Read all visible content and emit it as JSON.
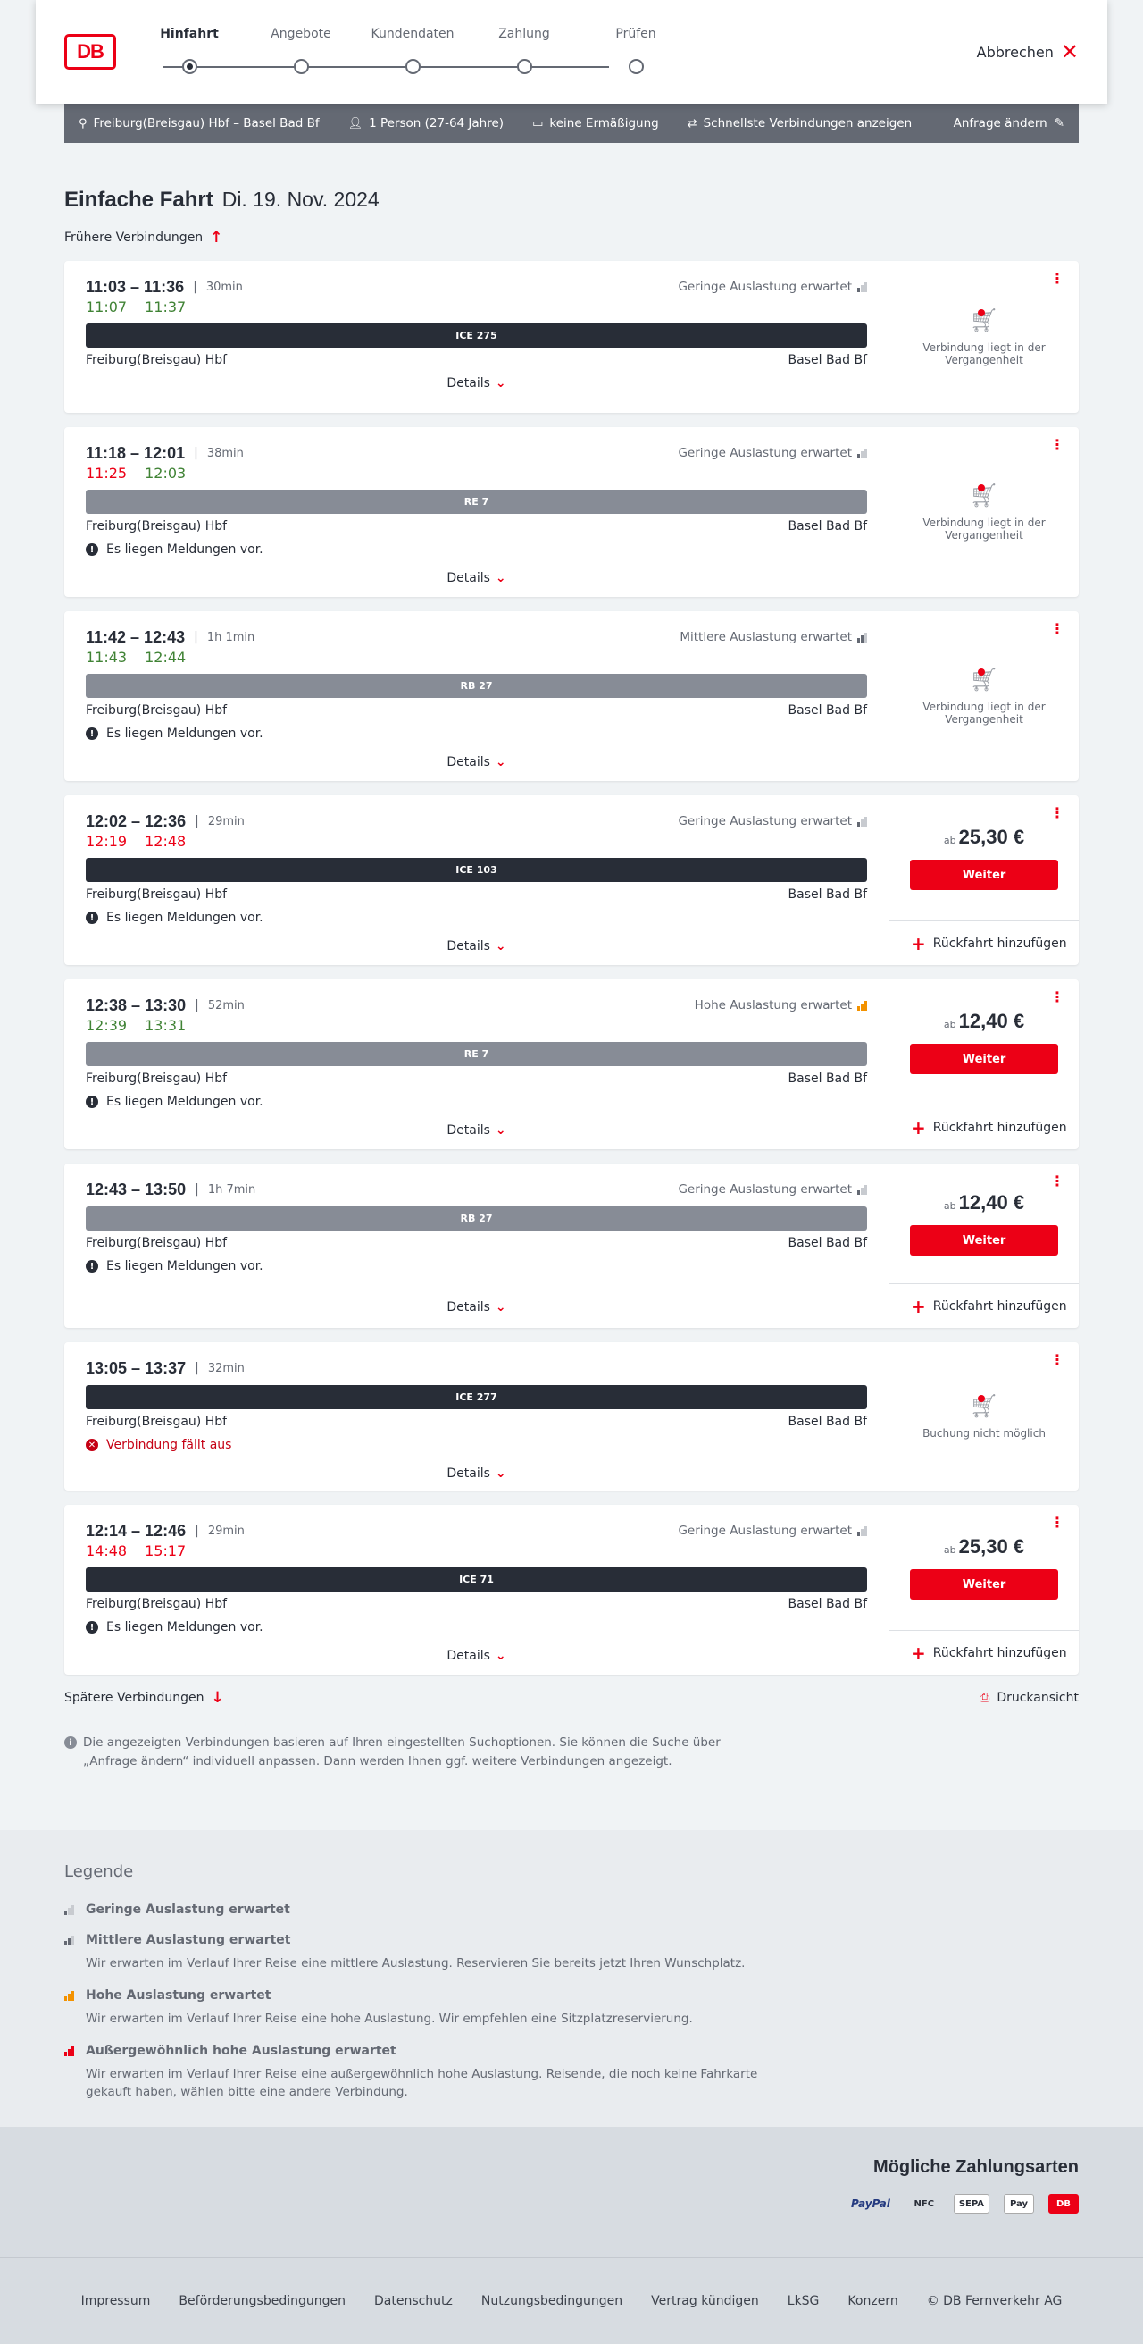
{
  "logo": "DB",
  "steps": [
    "Hinfahrt",
    "Angebote",
    "Kundendaten",
    "Zahlung",
    "Prüfen"
  ],
  "cancel": "Abbrechen",
  "summary": {
    "route": "Freiburg(Breisgau) Hbf – Basel Bad Bf",
    "persons": "1 Person (27-64 Jahre)",
    "discount": "keine Ermäßigung",
    "fastest": "Schnellste Verbindungen anzeigen",
    "edit": "Anfrage ändern"
  },
  "title": {
    "main": "Einfache Fahrt",
    "date": "Di. 19. Nov. 2024"
  },
  "earlier": "Frühere Verbindungen",
  "later": "Spätere Verbindungen",
  "print": "Druckansicht",
  "labels": {
    "details": "Details",
    "weiter": "Weiter",
    "return": "Rückfahrt hinzufügen",
    "ab": "ab",
    "past": "Verbindung liegt in der Vergangenheit",
    "notPossible": "Buchung nicht möglich",
    "notice": "Es liegen Meldungen vor.",
    "cancelled": "Verbindung fällt aus"
  },
  "connections": [
    {
      "times": "11:03 – 11:36",
      "duration": "30min",
      "load": "Geringe Auslastung erwartet",
      "loadLevel": 1,
      "rt": [
        {
          "t": "11:07",
          "c": "green"
        },
        {
          "t": "11:37",
          "c": "green"
        }
      ],
      "train": "ICE 275",
      "trainType": "ice",
      "from": "Freiburg(Breisgau) Hbf",
      "to": "Basel Bad Bf",
      "notice": "",
      "side": "past",
      "height": 170
    },
    {
      "times": "11:18 – 12:01",
      "duration": "38min",
      "load": "Geringe Auslastung erwartet",
      "loadLevel": 1,
      "rt": [
        {
          "t": "11:25",
          "c": "red"
        },
        {
          "t": "12:03",
          "c": "green"
        }
      ],
      "train": "RE 7",
      "trainType": "reg",
      "from": "Freiburg(Breisgau) Hbf",
      "to": "Basel Bad Bf",
      "notice": "notice",
      "side": "past",
      "height": 190
    },
    {
      "times": "11:42 – 12:43",
      "duration": "1h 1min",
      "load": "Mittlere Auslastung erwartet",
      "loadLevel": 2,
      "rt": [
        {
          "t": "11:43",
          "c": "green"
        },
        {
          "t": "12:44",
          "c": "green"
        }
      ],
      "train": "RB 27",
      "trainType": "reg",
      "from": "Freiburg(Breisgau) Hbf",
      "to": "Basel Bad Bf",
      "notice": "notice",
      "side": "past",
      "height": 190
    },
    {
      "times": "12:02 – 12:36",
      "duration": "29min",
      "load": "Geringe Auslastung erwartet",
      "loadLevel": 1,
      "rt": [
        {
          "t": "12:19",
          "c": "red"
        },
        {
          "t": "12:48",
          "c": "red"
        }
      ],
      "train": "ICE 103",
      "trainType": "ice",
      "from": "Freiburg(Breisgau) Hbf",
      "to": "Basel Bad Bf",
      "notice": "notice",
      "side": "price",
      "price": "25,30 €",
      "height": 190
    },
    {
      "times": "12:38 – 13:30",
      "duration": "52min",
      "load": "Hohe Auslastung erwartet",
      "loadLevel": 3,
      "rt": [
        {
          "t": "12:39",
          "c": "green"
        },
        {
          "t": "13:31",
          "c": "green"
        }
      ],
      "train": "RE 7",
      "trainType": "reg",
      "from": "Freiburg(Breisgau) Hbf",
      "to": "Basel Bad Bf",
      "notice": "notice",
      "side": "price",
      "price": "12,40 €",
      "height": 190
    },
    {
      "times": "12:43 – 13:50",
      "duration": "1h 7min",
      "load": "Geringe Auslastung erwartet",
      "loadLevel": 1,
      "rt": [],
      "train": "RB 27",
      "trainType": "reg",
      "from": "Freiburg(Breisgau) Hbf",
      "to": "Basel Bad Bf",
      "notice": "notice",
      "side": "price",
      "price": "12,40 €",
      "height": 184
    },
    {
      "times": "13:05 – 13:37",
      "duration": "32min",
      "load": "",
      "loadLevel": 0,
      "rt": [],
      "train": "ICE 277",
      "trainType": "ice",
      "from": "Freiburg(Breisgau) Hbf",
      "to": "Basel Bad Bf",
      "notice": "cancelled",
      "side": "notpossible",
      "height": 166
    },
    {
      "times": "12:14 – 12:46",
      "duration": "29min",
      "load": "Geringe Auslastung erwartet",
      "loadLevel": 1,
      "rt": [
        {
          "t": "14:48",
          "c": "red"
        },
        {
          "t": "15:17",
          "c": "red"
        }
      ],
      "train": "ICE 71",
      "trainType": "ice",
      "from": "Freiburg(Breisgau) Hbf",
      "to": "Basel Bad Bf",
      "notice": "notice",
      "side": "price",
      "price": "25,30 €",
      "height": 190
    }
  ],
  "info": "Die angezeigten Verbindungen basieren auf Ihren eingestellten Suchoptionen. Sie können die Suche über „Anfrage ändern“ individuell anpassen. Dann werden Ihnen ggf. weitere Verbindungen angezeigt.",
  "legend": {
    "title": "Legende",
    "items": [
      {
        "name": "Geringe Auslastung erwartet",
        "text": "",
        "level": 1
      },
      {
        "name": "Mittlere Auslastung erwartet",
        "text": "Wir erwarten im Verlauf Ihrer Reise eine mittlere Auslastung. Reservieren Sie bereits jetzt Ihren Wunschplatz.",
        "level": 2
      },
      {
        "name": "Hohe Auslastung erwartet",
        "text": "Wir erwarten im Verlauf Ihrer Reise eine hohe Auslastung. Wir empfehlen eine Sitzplatzreservierung.",
        "level": 3
      },
      {
        "name": "Außergewöhnlich hohe Auslastung erwartet",
        "text": "Wir erwarten im Verlauf Ihrer Reise eine außergewöhnlich hohe Auslastung. Reisende, die noch keine Fahrkarte gekauft haben, wählen bitte eine andere Verbindung.",
        "level": 4
      }
    ]
  },
  "payments": {
    "title": "Mögliche Zahlungsarten",
    "items": [
      "PayPal",
      "NFC",
      "SEPA",
      "Pay",
      "DB"
    ]
  },
  "footer": [
    "Impressum",
    "Beförderungsbedingungen",
    "Datenschutz",
    "Nutzungsbedingungen",
    "Vertrag kündigen",
    "LkSG",
    "Konzern",
    "© DB Fernverkehr AG"
  ],
  "colors": {
    "accent": "#ec0016",
    "green": "#408335",
    "dark": "#282d37",
    "gray": "#646973",
    "loadHigh": "#f39200"
  }
}
